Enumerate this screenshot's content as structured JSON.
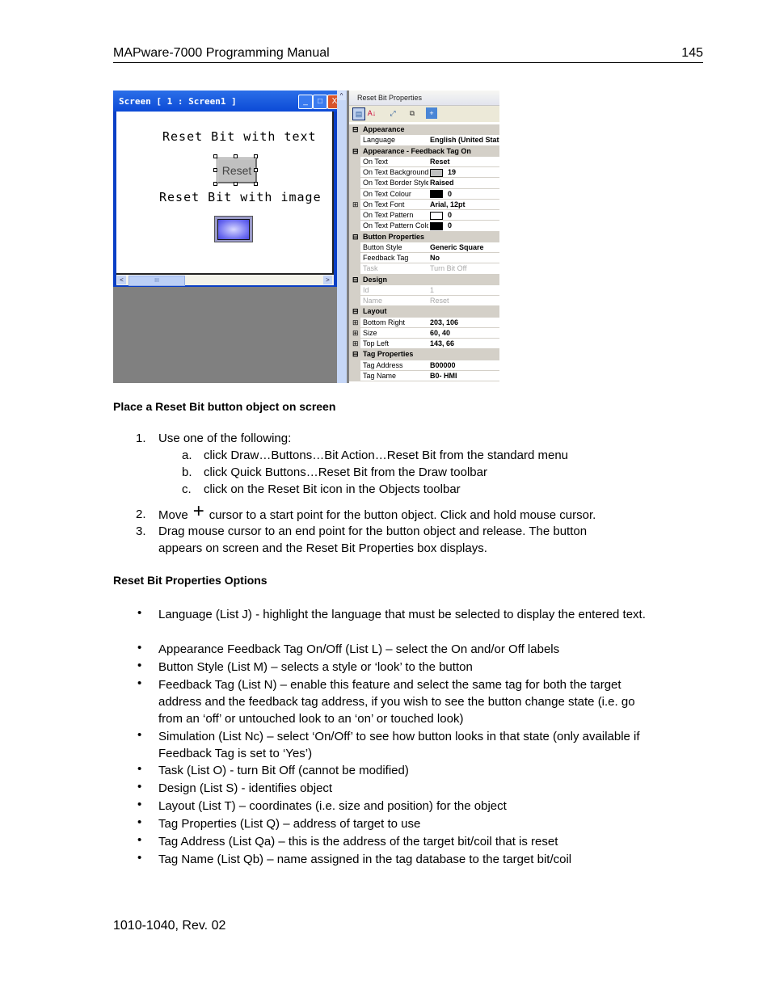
{
  "header": {
    "title": "MAPware-7000 Programming Manual",
    "page_number": "145"
  },
  "screen_window": {
    "title": "Screen [ 1 : Screen1 ]",
    "label_text_button": "Reset Bit with text",
    "reset_button_text": "Reset",
    "label_image_button": "Reset Bit with image",
    "scroll_left": "<",
    "scroll_right": ">",
    "scroll_thumb": "III",
    "scroll_up": "^",
    "minimize": "_",
    "maximize": "□",
    "close": "X"
  },
  "properties_panel": {
    "title": "Reset Bit Properties",
    "toolbar_icons": [
      "categorized-icon",
      "alphabetical-sort-icon",
      "expand-all-icon",
      "property-pages-icon",
      "add-icon"
    ],
    "rows": [
      {
        "type": "cat",
        "expander": "⊟",
        "name": "Appearance"
      },
      {
        "type": "prop",
        "name": "Language",
        "value": "English (United States)"
      },
      {
        "type": "cat",
        "expander": "⊟",
        "name": "Appearance - Feedback Tag On"
      },
      {
        "type": "prop",
        "name": "On Text",
        "value": "Reset"
      },
      {
        "type": "prop",
        "name": "On Text Background",
        "value": "19",
        "swatch": "#c0c0c0"
      },
      {
        "type": "prop",
        "name": "On Text Border Style",
        "value": "Raised"
      },
      {
        "type": "prop",
        "name": "On Text Colour",
        "value": "0",
        "swatch": "#000000"
      },
      {
        "type": "prop",
        "expander": "⊞",
        "name": "On Text Font",
        "value": "Arial, 12pt"
      },
      {
        "type": "prop",
        "name": "On Text Pattern",
        "value": "0",
        "swatch": "#ffffff"
      },
      {
        "type": "prop",
        "name": "On Text Pattern Colour",
        "value": "0",
        "swatch": "#000000"
      },
      {
        "type": "cat",
        "expander": "⊟",
        "name": "Button Properties"
      },
      {
        "type": "prop",
        "name": "Button Style",
        "value": "Generic Square"
      },
      {
        "type": "prop",
        "name": "Feedback Tag",
        "value": "No"
      },
      {
        "type": "prop",
        "name": "Task",
        "value": "Turn Bit Off",
        "disabled": true
      },
      {
        "type": "cat",
        "expander": "⊟",
        "name": "Design"
      },
      {
        "type": "prop",
        "name": "Id",
        "value": "1",
        "disabled": true
      },
      {
        "type": "prop",
        "name": "Name",
        "value": "Reset",
        "disabled": true
      },
      {
        "type": "cat",
        "expander": "⊟",
        "name": "Layout"
      },
      {
        "type": "prop",
        "expander": "⊞",
        "name": "Bottom Right",
        "value": "203, 106"
      },
      {
        "type": "prop",
        "expander": "⊞",
        "name": "Size",
        "value": "60, 40"
      },
      {
        "type": "prop",
        "expander": "⊞",
        "name": "Top Left",
        "value": "143, 66"
      },
      {
        "type": "cat",
        "expander": "⊟",
        "name": "Tag Properties"
      },
      {
        "type": "prop",
        "name": "Tag Address",
        "value": "B00000"
      },
      {
        "type": "prop",
        "name": "Tag Name",
        "value": "B0- HMI"
      }
    ]
  },
  "section1": {
    "heading": "Place a Reset Bit button object on screen",
    "step1": {
      "num": "1.",
      "text": "Use one of the following:"
    },
    "substeps": [
      {
        "num": "a.",
        "text": "click Draw…Buttons…Bit Action…Reset Bit from the standard menu"
      },
      {
        "num": "b.",
        "text": "click Quick Buttons…Reset Bit from the Draw toolbar"
      },
      {
        "num": "c.",
        "text": "click on the Reset Bit icon in the Objects toolbar"
      }
    ],
    "step2": {
      "num": "2.",
      "before": "Move",
      "cursor": "+",
      "after": "cursor to a start point for the button object. Click and hold mouse cursor."
    },
    "step3": {
      "num": "3.",
      "line1": "Drag mouse cursor to an end point for the button object and release. The button",
      "line2": "appears on screen and the Reset Bit Properties box displays."
    }
  },
  "section2": {
    "heading": "Reset Bit Properties Options",
    "bullet_glyph": "•",
    "bullets": [
      "Language (List J) - highlight the language that must be selected to display the entered text.",
      "Appearance Feedback Tag On/Off (List L) – select the On and/or Off labels",
      "Button Style (List M) – selects a style or ‘look’ to the button",
      "Feedback Tag (List N) – enable this feature and select the same tag for both the target address and the feedback tag address, if you wish to see the button change state (i.e. go from an ‘off’ or untouched look to an ‘on’ or touched look)",
      "Simulation (List Nc) – select ‘On/Off’ to see how button looks in that state (only available if Feedback Tag is set to ‘Yes’)",
      "Task (List O) - turn Bit Off (cannot be modified)",
      "Design (List S) - identifies object",
      "Layout (List T) – coordinates (i.e. size and position) for the object",
      "Tag Properties (List Q) – address of target to use",
      "Tag Address (List Qa) – this is the address of the target bit/coil that is reset",
      "Tag Name (List Qb) – name assigned in the tag database to the target bit/coil"
    ]
  },
  "footer": {
    "doc_id": "1010-1040, Rev. 02"
  }
}
